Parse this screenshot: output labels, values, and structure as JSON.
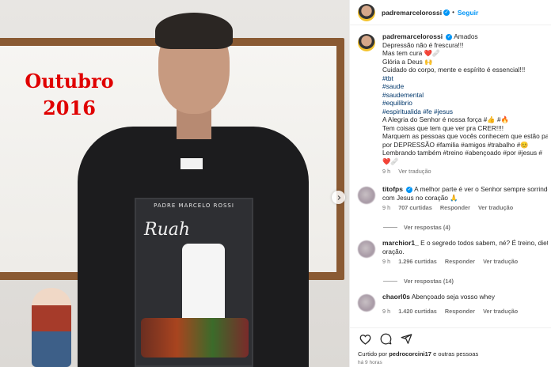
{
  "image": {
    "overlay_caption": "Outubro\n2016",
    "shirt_print_header": "PADRE MARCELO ROSSI",
    "shirt_print_title": "Ruah"
  },
  "header": {
    "username": "padremarcelorossi",
    "follow_label": "Seguir"
  },
  "caption": {
    "username": "padremarcelorossi",
    "lines": [
      "Amados",
      "Depressão não é frescura!!!",
      "Mas tem cura ❤️🩹",
      "Glória a Deus 🙌",
      "Cuidado do corpo, mente e espírito é essencial!!!",
      "#tbt",
      "#saude",
      "#saudemental",
      "#equilibrio",
      "#espiritualida #fe #jesus",
      "A Alegria do Senhor é nossa força #👍 #🔥",
      "Tem coisas que tem que ver pra CRER!!!!",
      "Marquem as pessoas que vocês conhecem que estão passando",
      "por DEPRESSÃO #familia #amigos #trabalho #😊",
      "Lembrando também #treino #abençoado #por #jesus #",
      "❤️🩹"
    ],
    "time": "9 h",
    "translate_label": "Ver tradução"
  },
  "comments": [
    {
      "username": "titofps",
      "verified": true,
      "text": "A melhor parte é ver o Senhor sempre sorrindo",
      "text2": "com Jesus no coração 🙏",
      "time": "9 h",
      "likes": "707 curtidas",
      "reply_label": "Responder",
      "translate_label": "Ver tradução",
      "replies_label": "Ver respostas (4)"
    },
    {
      "username": "marchior1_",
      "verified": false,
      "text": "E o segredo todos sabem, né? É treino, dieta e",
      "text2": "oração.",
      "time": "9 h",
      "likes": "1.296 curtidas",
      "reply_label": "Responder",
      "translate_label": "Ver tradução",
      "replies_label": "Ver respostas (14)"
    },
    {
      "username": "chaorl0s",
      "verified": false,
      "text": "Abençoado seja vosso whey",
      "text2": "",
      "time": "9 h",
      "likes": "1.420 curtidas",
      "reply_label": "Responder",
      "translate_label": "Ver tradução",
      "replies_label": ""
    }
  ],
  "footer": {
    "liked_by_prefix": "Curtido por",
    "liked_by_user": "pedrocorcini17",
    "liked_by_suffix": "e outras pessoas",
    "time_ago": "há 9 horas"
  },
  "icons": {
    "heart": "heart-icon",
    "comment": "comment-icon",
    "share": "share-icon",
    "next": "chevron-right-icon",
    "verified": "verified-badge-icon"
  },
  "colors": {
    "link_blue": "#0095f6",
    "hashtag": "#00376b",
    "overlay_red": "#e00000"
  }
}
